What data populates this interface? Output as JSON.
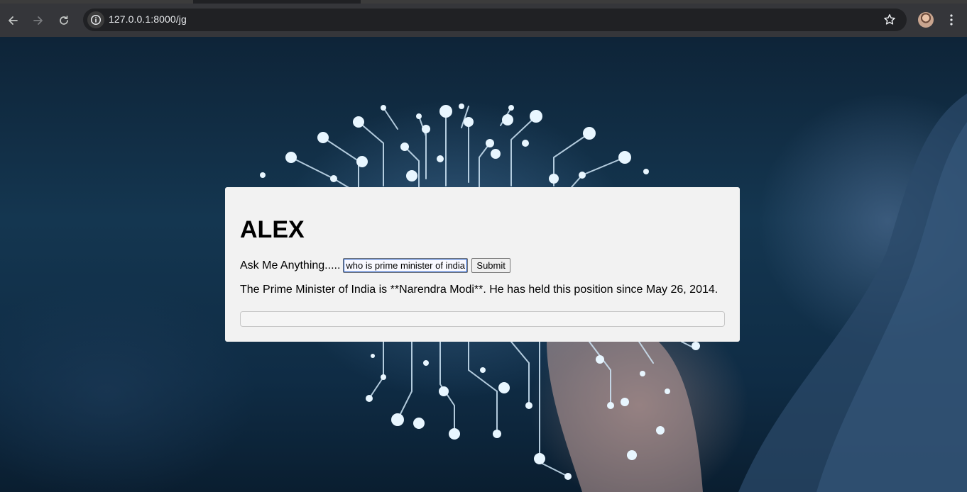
{
  "browser": {
    "url": "127.0.0.1:8000/jg",
    "icons": {
      "back": "arrow-left-icon",
      "forward": "arrow-right-icon",
      "reload": "reload-icon",
      "site_info": "info-icon",
      "bookmark": "star-icon",
      "profile": "avatar",
      "menu": "more-vertical-icon"
    }
  },
  "page": {
    "title": "ALEX",
    "ask_label": "Ask Me Anything.....",
    "question_input": {
      "value": "who is prime minister of india"
    },
    "submit_label": "Submit",
    "answer_text": "The Prime Minister of India is **Narendra Modi**. He has held this position since May 26, 2014.",
    "colors": {
      "card_background": "#f2f2f2",
      "chrome_toolbar": "#35363a",
      "omnibox": "#202124"
    }
  }
}
